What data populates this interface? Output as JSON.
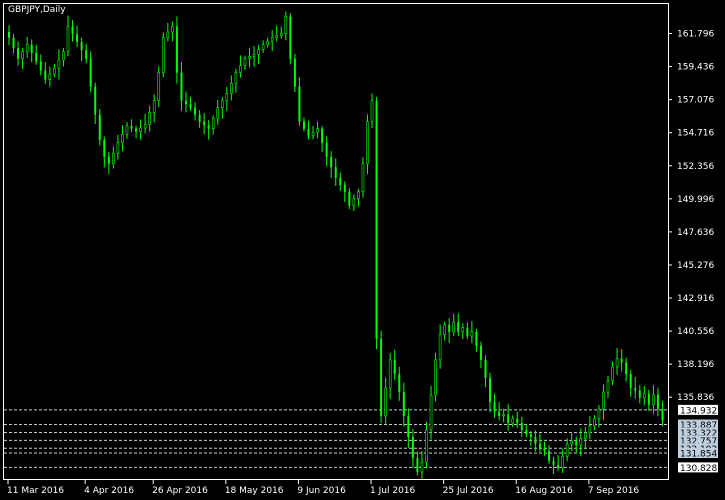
{
  "chart_title": "GBPJPY,Daily",
  "colors": {
    "background": "#000000",
    "frame": "#ffffff",
    "bull": "#00ff00",
    "bear": "#00ff00",
    "line_label_bg": "#c0d0e0",
    "level_label_bg": "#ffffff",
    "level_line": "#c8c8c8",
    "text": "#ffffff"
  },
  "chart_data": {
    "type": "candlestick",
    "symbol": "GBPJPY",
    "timeframe": "Daily",
    "ylim": [
      130.0,
      163.9
    ],
    "y_ticks": [
      "161.796",
      "159.436",
      "157.076",
      "154.716",
      "152.356",
      "149.996",
      "147.636",
      "145.276",
      "142.916",
      "140.556",
      "138.196",
      "135.836"
    ],
    "x_ticks": [
      "11 Mar 2016",
      "4 Apr 2016",
      "26 Apr 2016",
      "18 May 2016",
      "9 Jun 2016",
      "1 Jul 2016",
      "25 Jul 2016",
      "16 Aug 2016",
      "7 Sep 2016"
    ],
    "levels": [
      {
        "value": 134.932,
        "label": "134.932",
        "style": "white"
      },
      {
        "value": 133.887,
        "label": "133.887",
        "style": "light"
      },
      {
        "value": 133.322,
        "label": "133.322",
        "style": "light"
      },
      {
        "value": 132.757,
        "label": "132.757",
        "style": "light"
      },
      {
        "value": 132.192,
        "label": "132.192",
        "style": "light"
      },
      {
        "value": 131.854,
        "label": "131.854",
        "style": "light"
      },
      {
        "value": 130.828,
        "label": "130.828",
        "style": "white"
      }
    ],
    "close_path": [
      [
        0,
        161.5
      ],
      [
        2,
        160.0
      ],
      [
        4,
        161.0
      ],
      [
        6,
        159.8
      ],
      [
        8,
        158.5
      ],
      [
        10,
        159.3
      ],
      [
        12,
        160.5
      ],
      [
        13,
        162.3
      ],
      [
        15,
        161.2
      ],
      [
        17,
        160.0
      ],
      [
        18,
        158.0
      ],
      [
        19,
        156.0
      ],
      [
        20,
        154.2
      ],
      [
        21,
        153.0
      ],
      [
        22,
        152.5
      ],
      [
        24,
        154.0
      ],
      [
        26,
        155.2
      ],
      [
        28,
        154.8
      ],
      [
        30,
        155.3
      ],
      [
        32,
        157.0
      ],
      [
        33,
        159.0
      ],
      [
        34,
        161.5
      ],
      [
        36,
        162.3
      ],
      [
        37,
        159.0
      ],
      [
        38,
        157.0
      ],
      [
        40,
        156.5
      ],
      [
        42,
        155.5
      ],
      [
        44,
        155.0
      ],
      [
        46,
        156.5
      ],
      [
        48,
        157.5
      ],
      [
        50,
        159.0
      ],
      [
        52,
        160.0
      ],
      [
        54,
        160.3
      ],
      [
        56,
        161.0
      ],
      [
        58,
        161.5
      ],
      [
        60,
        161.8
      ],
      [
        61,
        163.0
      ],
      [
        62,
        160.0
      ],
      [
        63,
        158.0
      ],
      [
        64,
        155.5
      ],
      [
        66,
        154.5
      ],
      [
        68,
        155.0
      ],
      [
        70,
        153.0
      ],
      [
        72,
        151.5
      ],
      [
        74,
        150.5
      ],
      [
        75,
        149.5
      ],
      [
        77,
        150.5
      ],
      [
        78,
        152.5
      ],
      [
        79,
        155.5
      ],
      [
        80,
        157.0
      ],
      [
        81,
        140.0
      ],
      [
        82,
        134.5
      ],
      [
        83,
        136.5
      ],
      [
        84,
        138.5
      ],
      [
        85,
        137.5
      ],
      [
        86,
        136.2
      ],
      [
        87,
        134.5
      ],
      [
        88,
        133.0
      ],
      [
        89,
        131.5
      ],
      [
        90,
        130.5
      ],
      [
        91,
        131.2
      ],
      [
        92,
        133.5
      ],
      [
        93,
        136.0
      ],
      [
        94,
        138.5
      ],
      [
        95,
        140.3
      ],
      [
        96,
        141.0
      ],
      [
        97,
        140.5
      ],
      [
        98,
        141.2
      ],
      [
        99,
        140.5
      ],
      [
        100,
        140.8
      ],
      [
        101,
        140.2
      ],
      [
        102,
        140.5
      ],
      [
        103,
        139.5
      ],
      [
        104,
        138.5
      ],
      [
        105,
        137.2
      ],
      [
        106,
        135.5
      ],
      [
        107,
        134.8
      ],
      [
        108,
        134.5
      ],
      [
        109,
        134.6
      ],
      [
        110,
        134.0
      ],
      [
        111,
        134.3
      ],
      [
        112,
        134.0
      ],
      [
        113,
        133.5
      ],
      [
        114,
        133.2
      ],
      [
        115,
        133.0
      ],
      [
        116,
        132.5
      ],
      [
        117,
        132.2
      ],
      [
        118,
        132.0
      ],
      [
        119,
        131.3
      ],
      [
        120,
        131.0
      ],
      [
        121,
        130.8
      ],
      [
        122,
        131.6
      ],
      [
        123,
        132.5
      ],
      [
        124,
        132.7
      ],
      [
        125,
        132.4
      ],
      [
        126,
        132.9
      ],
      [
        127,
        133.3
      ],
      [
        128,
        133.8
      ],
      [
        129,
        134.3
      ],
      [
        130,
        135.0
      ],
      [
        131,
        136.2
      ],
      [
        132,
        137.0
      ],
      [
        133,
        138.0
      ],
      [
        134,
        138.6
      ],
      [
        135,
        138.3
      ],
      [
        136,
        137.5
      ],
      [
        137,
        136.5
      ],
      [
        138,
        136.3
      ],
      [
        139,
        135.8
      ],
      [
        140,
        136.1
      ],
      [
        141,
        135.3
      ],
      [
        142,
        136.0
      ],
      [
        143,
        135.0
      ],
      [
        144,
        134.2
      ]
    ]
  }
}
